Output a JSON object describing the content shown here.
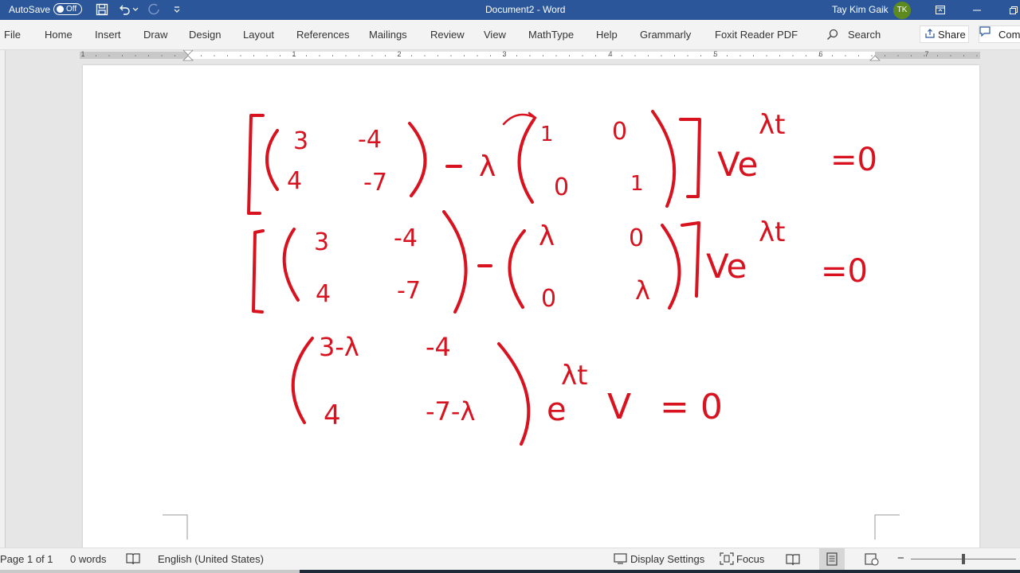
{
  "titlebar": {
    "autosave_label": "AutoSave",
    "autosave_state": "Off",
    "document_title": "Document2 - Word",
    "user_name": "Tay Kim Gaik",
    "user_initials": "TK"
  },
  "menu": {
    "items": [
      "File",
      "Home",
      "Insert",
      "Draw",
      "Design",
      "Layout",
      "References",
      "Mailings",
      "Review",
      "View",
      "MathType",
      "Help",
      "Grammarly",
      "Foxit Reader PDF"
    ],
    "search_label": "Search",
    "share_label": "Share",
    "comments_label": "Com"
  },
  "ruler": {
    "numbers": [
      "1",
      "1",
      "2",
      "3",
      "4",
      "5",
      "6",
      "7"
    ]
  },
  "statusbar": {
    "page_info": "Page 1 of 1",
    "word_count": "0 words",
    "language": "English (United States)",
    "display_settings": "Display Settings",
    "focus": "Focus",
    "zoom_minus": "−"
  },
  "ink": {
    "color": "#d8121f",
    "line1": {
      "matrix_a": [
        [
          "3",
          "-4"
        ],
        [
          "4",
          "-7"
        ]
      ],
      "operator": "-",
      "scalar": "λ",
      "matrix_i": [
        [
          "1",
          "0"
        ],
        [
          "0",
          "1"
        ]
      ],
      "tail": "Ve",
      "exponent": "λt",
      "rhs": "=0"
    },
    "line2": {
      "matrix_a": [
        [
          "3",
          "-4"
        ],
        [
          "4",
          "-7"
        ]
      ],
      "operator": "-",
      "matrix_l": [
        [
          "λ",
          "0"
        ],
        [
          "0",
          "λ"
        ]
      ],
      "tail": "Ve",
      "exponent": "λt",
      "rhs": "=0"
    },
    "line3": {
      "matrix": [
        [
          "3-λ",
          "-4"
        ],
        [
          "4",
          "-7-λ"
        ]
      ],
      "tail": "e",
      "exponent": "λt",
      "vector": "V",
      "rhs": "= 0"
    }
  }
}
